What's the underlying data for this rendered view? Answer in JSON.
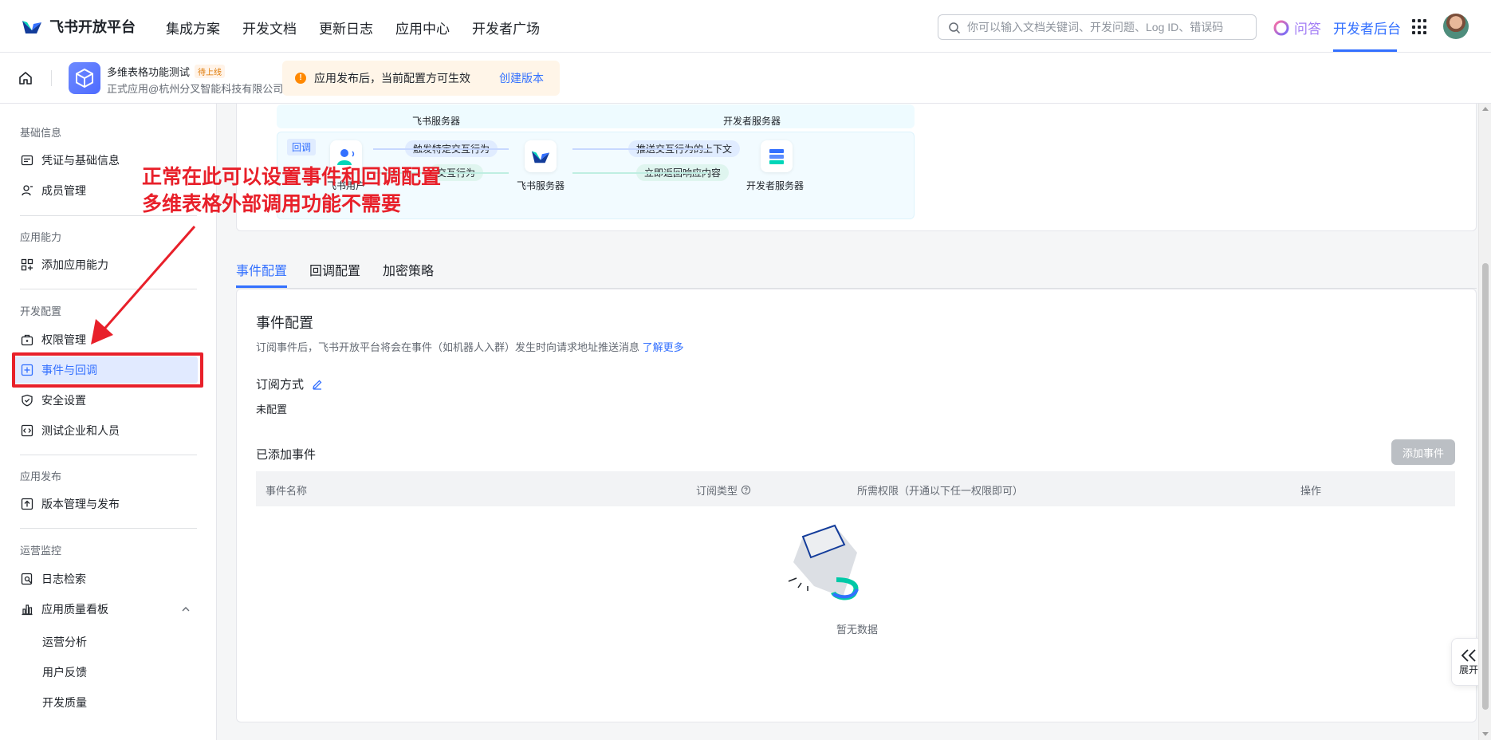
{
  "topnav": {
    "brand": "飞书开放平台",
    "links": [
      "集成方案",
      "开发文档",
      "更新日志",
      "应用中心",
      "开发者广场"
    ],
    "search_placeholder": "你可以输入文档关键词、开发问题、Log ID、错误码",
    "ask": "问答",
    "dev_console": "开发者后台"
  },
  "app_header": {
    "app_name": "多维表格功能测试",
    "status_badge": "待上线",
    "org": "正式应用@杭州分叉智能科技有限公司",
    "notice": "应用发布后，当前配置方可生效",
    "notice_link": "创建版本"
  },
  "sidebar": {
    "groups": [
      "基础信息",
      "应用能力",
      "开发配置",
      "应用发布",
      "运营监控"
    ],
    "items": [
      "凭证与基础信息",
      "成员管理",
      "添加应用能力",
      "权限管理",
      "事件与回调",
      "安全设置",
      "测试企业和人员",
      "版本管理与发布",
      "日志检索",
      "应用质量看板"
    ],
    "sub_items": [
      "运营分析",
      "用户反馈",
      "开发质量"
    ]
  },
  "diagram": {
    "top_left": "飞书服务器",
    "top_right": "开发者服务器",
    "callback_tag": "回调",
    "user_label": "飞书用户",
    "pill_trigger": "触发特定交互行为",
    "pill_response": "交互行为",
    "feishu_server": "飞书服务器",
    "pill_push": "推送交互行为的上下文",
    "pill_return": "立即返回响应内容",
    "dev_server": "开发者服务器"
  },
  "tabs": [
    "事件配置",
    "回调配置",
    "加密策略"
  ],
  "content": {
    "title": "事件配置",
    "desc": "订阅事件后，飞书开放平台将会在事件（如机器人入群）发生时向请求地址推送消息",
    "desc_link": "了解更多",
    "sub_label": "订阅方式",
    "sub_value": "未配置",
    "added_label": "已添加事件",
    "add_button": "添加事件",
    "columns": [
      "事件名称",
      "订阅类型",
      "所需权限（开通以下任一权限即可）",
      "操作"
    ],
    "empty": "暂无数据"
  },
  "annotation": {
    "line1": "正常在此可以设置事件和回调配置",
    "line2": "多维表格外部调用功能不需要"
  },
  "expand": "展开",
  "colors": {
    "accent": "#3370ff",
    "annotation": "#e8202a"
  }
}
